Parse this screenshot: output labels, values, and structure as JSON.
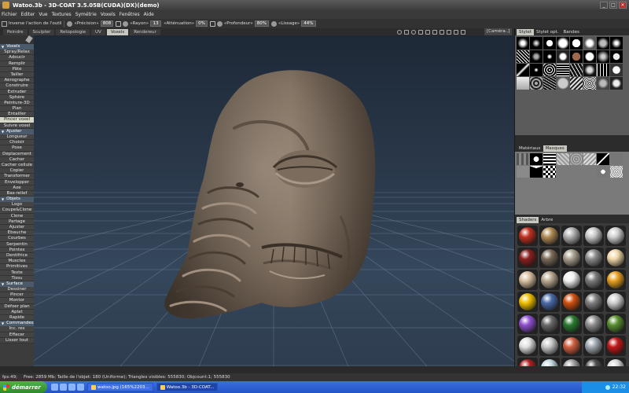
{
  "window": {
    "title": "Watoo.3b - 3D-COAT 3.5.05B(CUDA)(DX)(demo)"
  },
  "menu": [
    "Fichier",
    "Editer",
    "Vue",
    "Textures",
    "Symétrie",
    "Voxels",
    "Fenêtres",
    "Aide"
  ],
  "options": {
    "invert_label": "Inverse l'action de l'outil",
    "precision_label": "«Précision»",
    "precision_value": "808",
    "radius_label": "«Rayon»",
    "radius_value": "13",
    "attenuation_label": "«Atténuation»",
    "attenuation_value": "0%",
    "depth_label": "«Profondeur»",
    "depth_value": "80%",
    "smoothing_label": "«Lissage»",
    "smoothing_value": "44%"
  },
  "rooms": [
    {
      "label": "Peindre",
      "active": false
    },
    {
      "label": "Sculpter",
      "active": false
    },
    {
      "label": "Retopologie",
      "active": false
    },
    {
      "label": "UV",
      "active": false
    },
    {
      "label": "Voxels",
      "active": true
    },
    {
      "label": "Rendereur",
      "active": false
    }
  ],
  "camera_label": "[Caméra..]",
  "left_panel": {
    "sections": [
      {
        "title": "Voxels",
        "items": [
          "Spray/Relax",
          "Adoucir",
          "Remplir",
          "Pâte",
          "Tailler",
          "Aérographe",
          "Construire",
          "Extruder",
          "Sphère",
          "Peinture-3D",
          "Plan",
          "Entailler",
          "Pincer voxel",
          "Suivre voxel"
        ],
        "active": "Pincer voxel"
      },
      {
        "title": "Ajuster",
        "items": [
          "Longueur",
          "Choisir",
          "Pose",
          "Déplacement",
          "Cacher",
          "Cacher cellule",
          "Copier",
          "Transformer",
          "Envelopper",
          "Axe",
          "Bas-relief"
        ]
      },
      {
        "title": "Objets",
        "items": [
          "Logo",
          "Coupe&Clone",
          "Clone",
          "Partage",
          "Ajuster",
          "Ebauche",
          "Courbes",
          "Serpentin",
          "Pointes",
          "Dentifrice",
          "Muscles",
          "Primitives",
          "Texte",
          "Tissu"
        ]
      },
      {
        "title": "Surface",
        "items": [
          "Dessiner",
          "Pincer",
          "Montor",
          "Défoer plan",
          "Aplat",
          "Rapide"
        ]
      },
      {
        "title": "Commandes",
        "items": [
          "Inc. res",
          "Effacer",
          "Lisser tout"
        ]
      }
    ]
  },
  "right_panels": {
    "top_tabs": [
      "Stylet",
      "Stylet opt.",
      "Bandes"
    ],
    "mid_tabs": [
      "Matériaux",
      "Masques"
    ],
    "bottom_tabs": [
      "Shaders",
      "Arbre"
    ],
    "shader_colors": [
      "#c03020",
      "#b08a55",
      "#b0b0b0",
      "#c8c8c8",
      "#d0d0d0",
      "#8a2020",
      "#7a6a58",
      "#aaa090",
      "#8a8a8a",
      "#f0d8a8",
      "#d8c0a0",
      "#b8a890",
      "#f0f0f0",
      "#7a7a7a",
      "#e8a020",
      "#f0c000",
      "#4a6aa8",
      "#d05010",
      "#808080",
      "#d0d0d0",
      "#9050d0",
      "#6a6a6a",
      "#2a7a30",
      "#909090",
      "#5a9030",
      "#e0e0e0",
      "#c8c8c8",
      "#d06040",
      "#a0a8b0",
      "#c01818",
      "#b02020",
      "#c0d8e0",
      "#a0a0a0",
      "#505050",
      "#d8d8d8"
    ]
  },
  "status": {
    "fps": "fps:49;",
    "free": "Free: 2859 Mb; Taille de l'objet: 180 (Uniforme); Triangles visibles: 555830; Objcount:1; 555830"
  },
  "taskbar": {
    "start": "démarrer",
    "tasks": [
      "watoo.jpg (165%2203...",
      "Watoo.3b - 3D-COAT..."
    ],
    "clock": "22:32"
  }
}
